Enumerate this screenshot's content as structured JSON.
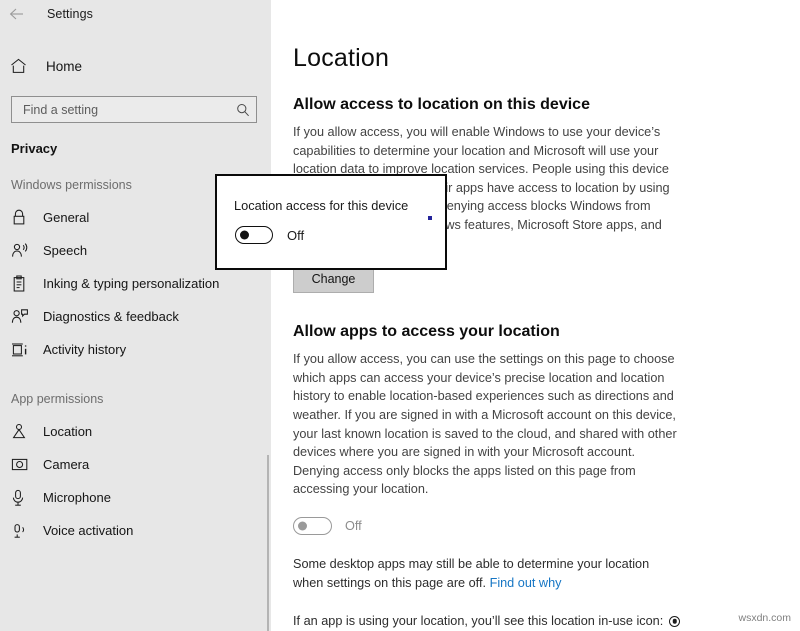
{
  "window": {
    "title": "Settings",
    "back_icon": "back-arrow-icon"
  },
  "sidebar": {
    "home": {
      "label": "Home",
      "icon": "home-icon"
    },
    "search": {
      "placeholder": "Find a setting",
      "value": "",
      "icon": "search-icon"
    },
    "category": "Privacy",
    "groups": [
      {
        "header": "Windows permissions",
        "items": [
          {
            "label": "General",
            "icon": "lock-icon"
          },
          {
            "label": "Speech",
            "icon": "speech-person-icon"
          },
          {
            "label": "Inking & typing personalization",
            "icon": "clipboard-pen-icon"
          },
          {
            "label": "Diagnostics & feedback",
            "icon": "feedback-person-icon"
          },
          {
            "label": "Activity history",
            "icon": "activity-history-icon"
          }
        ]
      },
      {
        "header": "App permissions",
        "items": [
          {
            "label": "Location",
            "icon": "location-pin-icon"
          },
          {
            "label": "Camera",
            "icon": "camera-icon"
          },
          {
            "label": "Microphone",
            "icon": "microphone-icon"
          },
          {
            "label": "Voice activation",
            "icon": "voice-activation-icon"
          }
        ]
      }
    ]
  },
  "main": {
    "page_title": "Location",
    "device_section": {
      "heading": "Allow access to location on this device",
      "body": "If you allow access, you will enable Windows to use your device’s capabilities to determine your location and Microsoft will use your location data to improve location services. People using this device will be able to choose if their apps have access to location by using the settings on this page. Denying access blocks Windows from providing location to Windows features, Microsoft Store apps, and most desktop apps.",
      "change_button": "Change"
    },
    "apps_section": {
      "heading": "Allow apps to access your location",
      "body": "If you allow access, you can use the settings on this page to choose which apps can access your device’s precise location and location history to enable location-based experiences such as directions and weather. If you are signed in with a Microsoft account on this device, your last known location is saved to the cloud, and shared with other devices where you are signed in with your Microsoft account. Denying access only blocks the apps listed on this page from accessing your location.",
      "toggle": {
        "state": "Off",
        "enabled": false
      }
    },
    "desktop_note": {
      "text": "Some desktop apps may still be able to determine your location when settings on this page are off. ",
      "link": "Find out why"
    },
    "inuse_note": {
      "text": "If an app is using your location, you’ll see this location in-use icon: ",
      "icon": "location-in-use-icon"
    }
  },
  "popup": {
    "title": "Location access for this device",
    "toggle": {
      "state": "Off"
    }
  },
  "watermark": "wsxdn.com",
  "colors": {
    "sidebar_bg": "#e7e7e7",
    "content_bg": "#ffffff",
    "link": "#1676c4",
    "text": "#151515",
    "muted": "#6d6d6d"
  }
}
